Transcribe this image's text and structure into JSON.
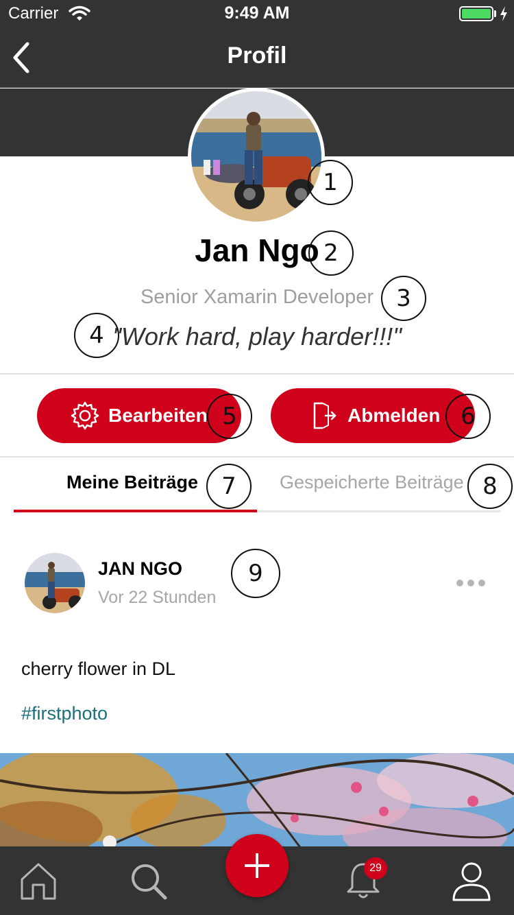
{
  "status_bar": {
    "carrier": "Carrier",
    "time": "9:49 AM"
  },
  "nav": {
    "title": "Profil"
  },
  "profile": {
    "name": "Jan Ngo",
    "job_title": "Senior Xamarin Developer",
    "quote": "\"Work hard, play harder!!!\""
  },
  "actions": {
    "edit_label": "Bearbeiten",
    "logout_label": "Abmelden"
  },
  "tabs": [
    {
      "label": "Meine Beiträge",
      "active": true
    },
    {
      "label": "Gespeicherte Beiträge",
      "active": false
    }
  ],
  "post": {
    "author": "JAN NGO",
    "time": "Vor 22 Stunden",
    "text": "cherry flower in DL",
    "hashtag": "#firstphoto"
  },
  "tabbar": {
    "notifications_count": "29"
  },
  "annotations": [
    "1",
    "2",
    "3",
    "4",
    "5",
    "6",
    "7",
    "8",
    "9"
  ],
  "colors": {
    "accent": "#d0021b",
    "header": "#333333",
    "hashtag": "#1b6f7a",
    "muted": "#9e9e9e"
  },
  "icons": [
    "back-chevron-icon",
    "gear-icon",
    "logout-icon",
    "home-icon",
    "search-icon",
    "plus-icon",
    "bell-icon",
    "user-icon",
    "more-icon",
    "wifi-icon",
    "battery-icon"
  ]
}
